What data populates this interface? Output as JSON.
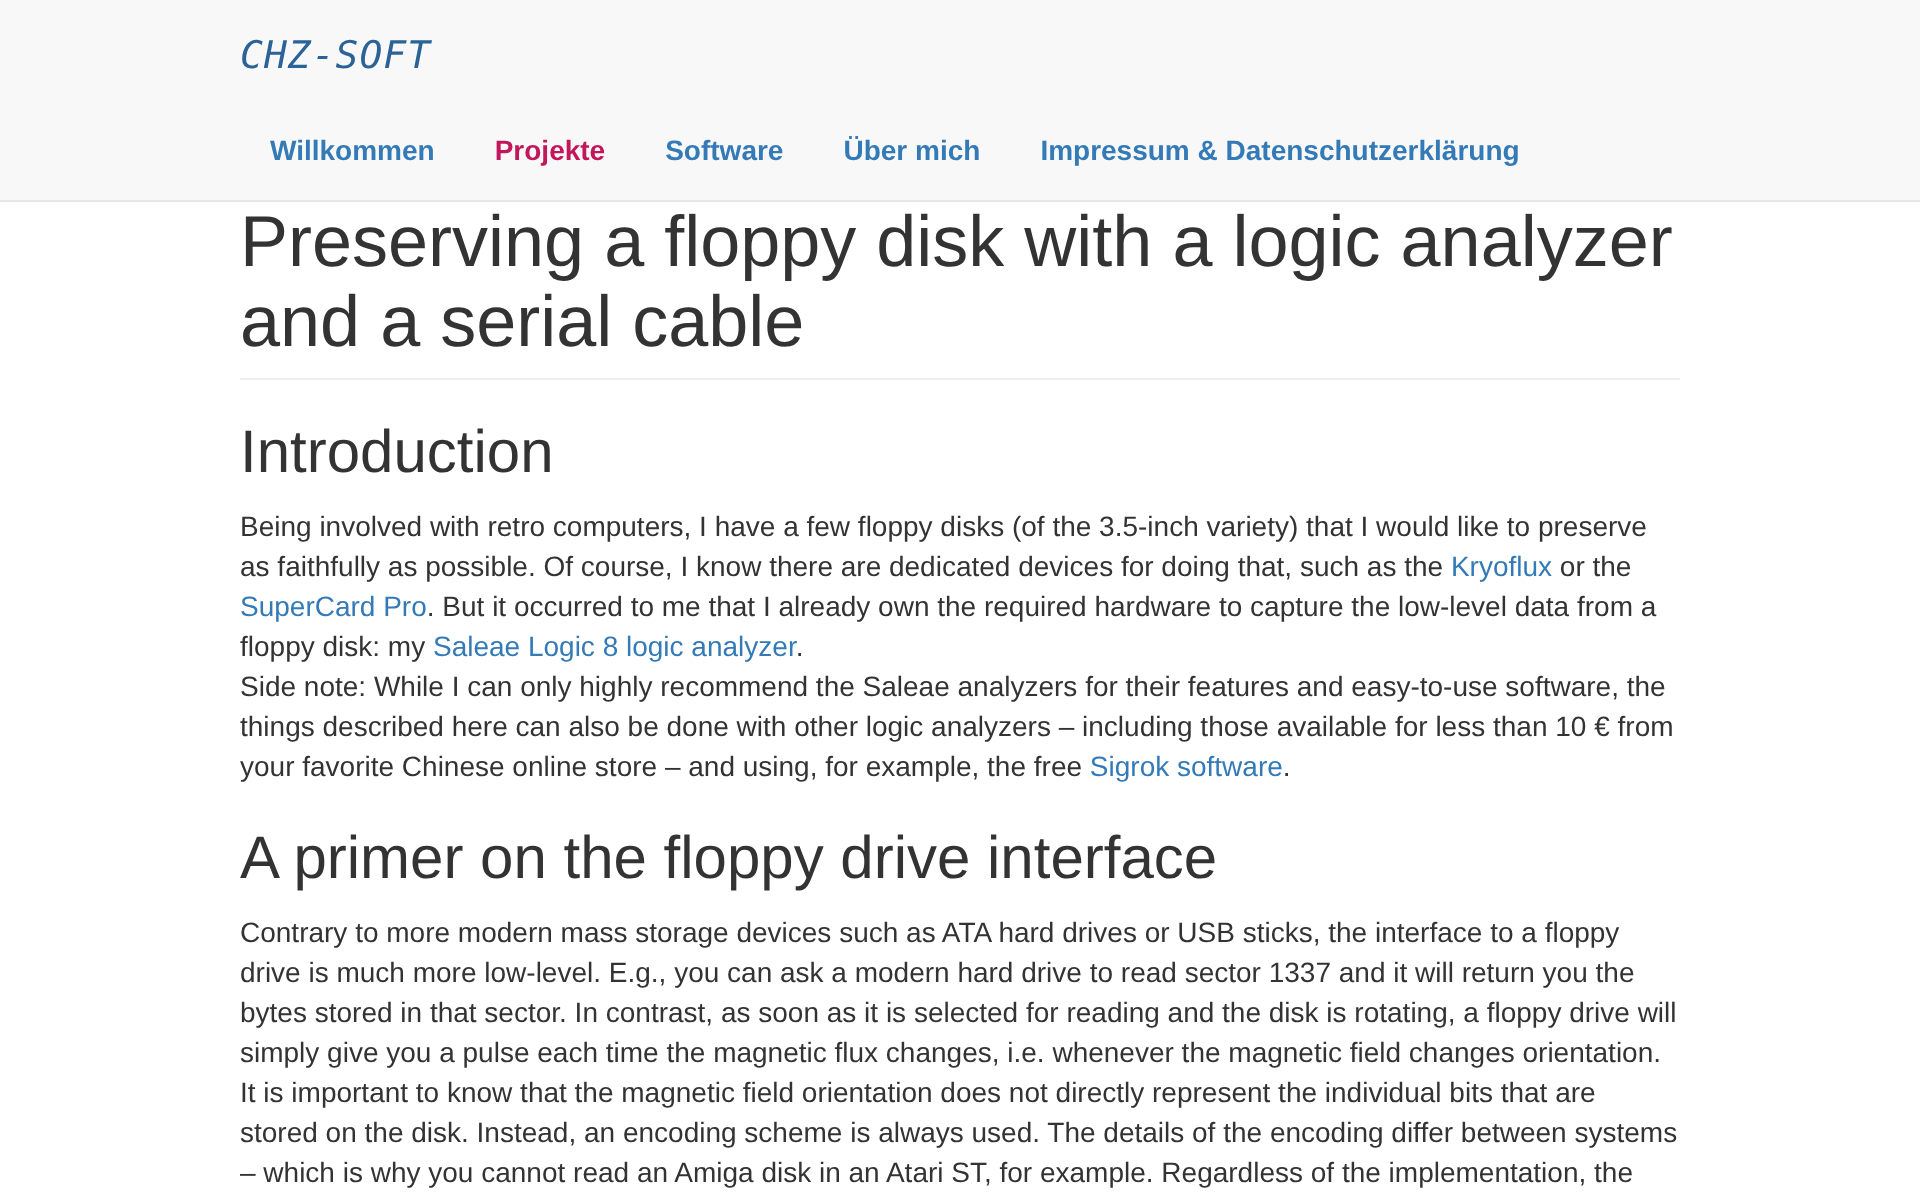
{
  "header": {
    "logo": "CHZ-SOFT",
    "nav": [
      {
        "label": "Willkommen",
        "selected": false
      },
      {
        "label": "Projekte",
        "selected": true
      },
      {
        "label": "Software",
        "selected": false
      },
      {
        "label": "Über mich",
        "selected": false
      },
      {
        "label": "Impressum & Datenschutzerklärung",
        "selected": false
      }
    ]
  },
  "article": {
    "title": "Preserving a floppy disk with a logic analyzer and a serial cable",
    "sections": [
      {
        "heading": "Introduction",
        "paragraphs": [
          [
            {
              "kind": "text",
              "text": "Being involved with retro computers, I have a few floppy disks (of the 3.5-inch variety) that I would like to preserve as faithfully as possible. Of course, I know there are dedicated devices for doing that, such as the "
            },
            {
              "kind": "link",
              "text": "Kryoflux"
            },
            {
              "kind": "text",
              "text": " or the "
            },
            {
              "kind": "link",
              "text": "SuperCard Pro"
            },
            {
              "kind": "text",
              "text": ". But it occurred to me that I already own the required hardware to capture the low-level data from a floppy disk: my "
            },
            {
              "kind": "link",
              "text": "Saleae Logic 8 logic analyzer"
            },
            {
              "kind": "text",
              "text": "."
            },
            {
              "kind": "break"
            },
            {
              "kind": "text",
              "text": "Side note: While I can only highly recommend the Saleae analyzers for their features and easy-to-use software, the things described here can also be done with other logic analyzers – including those available for less than 10 € from your favorite Chinese online store – and using, for example, the free "
            },
            {
              "kind": "link",
              "text": "Sigrok software"
            },
            {
              "kind": "text",
              "text": "."
            }
          ]
        ]
      },
      {
        "heading": "A primer on the floppy drive interface",
        "paragraphs": [
          [
            {
              "kind": "text",
              "text": "Contrary to more modern mass storage devices such as ATA hard drives or USB sticks, the interface to a floppy drive is much more low-level. E.g., you can ask a modern hard drive to read sector 1337 and it will return you the bytes stored in that sector. In contrast, as soon as it is selected for reading and the disk is rotating, a floppy drive will simply give you a pulse each time the magnetic flux changes, i.e. whenever the magnetic field changes orientation. It is important to know that the magnetic field orientation does not directly represent the individual bits that are stored on the disk. Instead, an encoding scheme is always used. The details of the encoding differ between systems – which is why you cannot read an Amiga disk in an Atari ST, for example. Regardless of the implementation, the"
            }
          ]
        ]
      }
    ]
  }
}
